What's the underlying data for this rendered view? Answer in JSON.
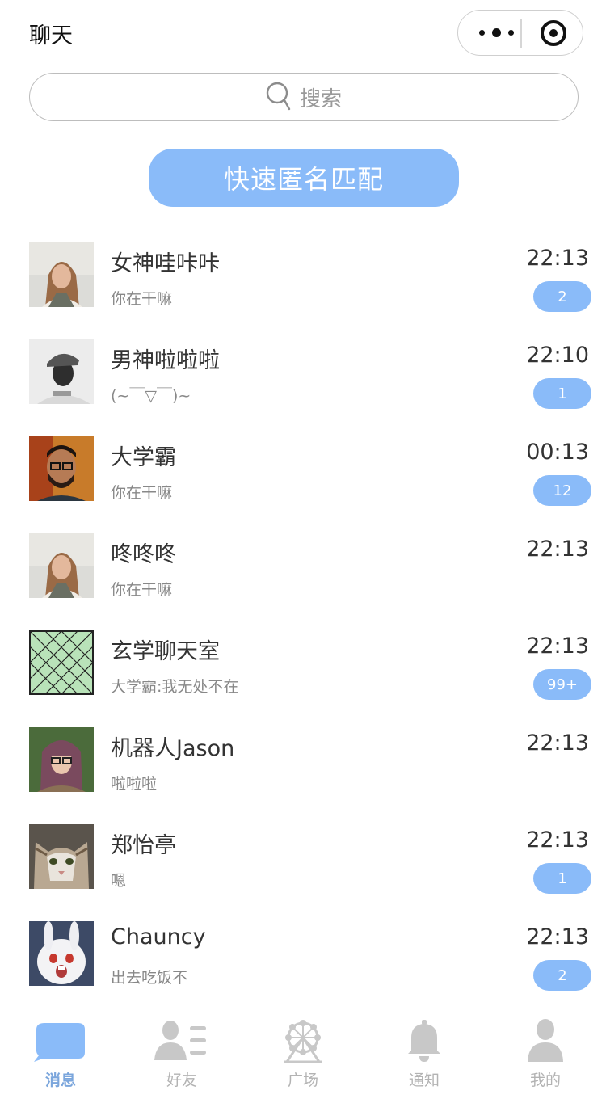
{
  "navbar": {
    "title": "聊天"
  },
  "search": {
    "placeholder": "搜索"
  },
  "quick_match": {
    "label": "快速匿名匹配"
  },
  "chats": [
    {
      "name": "女神哇咔咔",
      "preview": "你在干嘛",
      "time": "22:13",
      "badge": "2",
      "avatar": "woman-photo"
    },
    {
      "name": "男神啦啦啦",
      "preview": "(~￣▽￣)~",
      "time": "22:10",
      "badge": "1",
      "avatar": "man-cap-photo"
    },
    {
      "name": "大学霸",
      "preview": "你在干嘛",
      "time": "00:13",
      "badge": "12",
      "avatar": "man-glasses-photo"
    },
    {
      "name": "咚咚咚",
      "preview": "你在干嘛",
      "time": "22:13",
      "badge": "",
      "avatar": "woman-photo"
    },
    {
      "name": "玄学聊天室",
      "preview": "大学霸:我无处不在",
      "time": "22:13",
      "badge": "99+",
      "avatar": "placeholder-image"
    },
    {
      "name": "机器人Jason",
      "preview": "啦啦啦",
      "time": "22:13",
      "badge": "",
      "avatar": "woman-glasses-photo"
    },
    {
      "name": "郑怡亭",
      "preview": "嗯",
      "time": "22:13",
      "badge": "1",
      "avatar": "cat-photo"
    },
    {
      "name": "Chauncy",
      "preview": "出去吃饭不",
      "time": "22:13",
      "badge": "2",
      "avatar": "rabbit-photo"
    }
  ],
  "tabbar": {
    "tabs": [
      {
        "label": "消息",
        "icon": "chat-bubble-icon",
        "active": true
      },
      {
        "label": "好友",
        "icon": "friends-list-icon",
        "active": false
      },
      {
        "label": "广场",
        "icon": "ferris-wheel-icon",
        "active": false
      },
      {
        "label": "通知",
        "icon": "bell-icon",
        "active": false
      },
      {
        "label": "我的",
        "icon": "person-icon",
        "active": false
      }
    ]
  },
  "colors": {
    "accent": "#8abbf9",
    "tab_active": "#7ba6dc",
    "tab_inactive": "#c8c8c8"
  }
}
